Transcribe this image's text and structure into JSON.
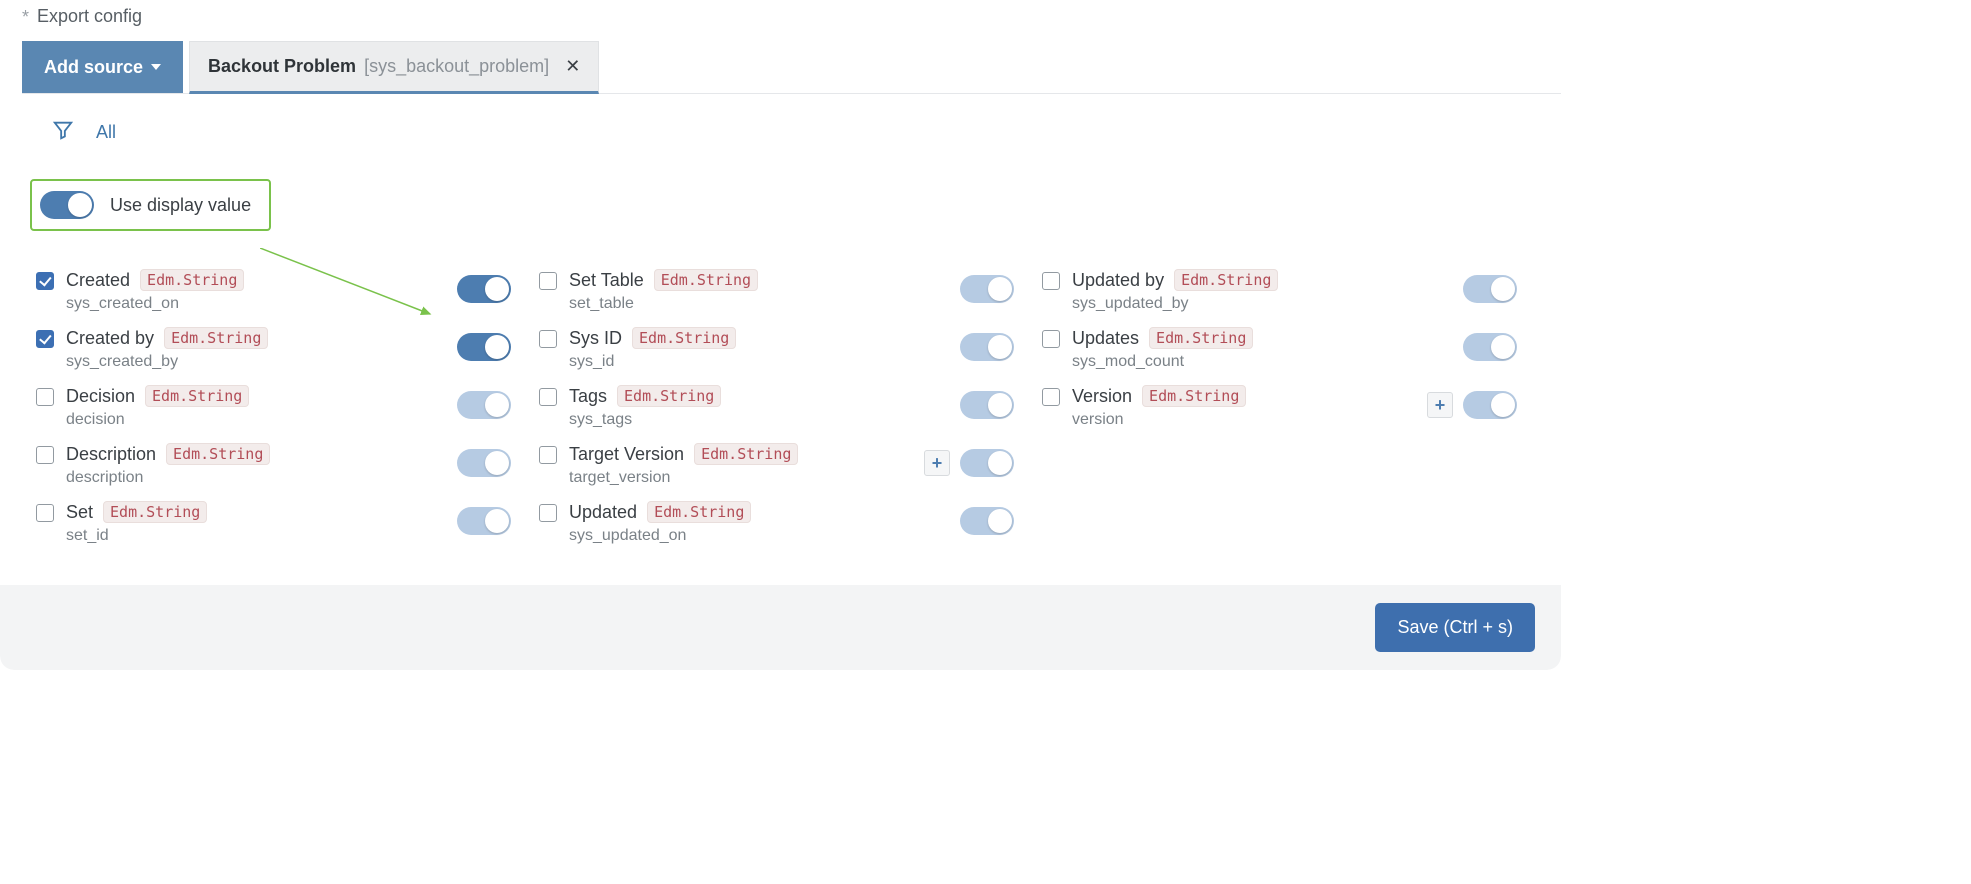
{
  "breadcrumb": {
    "label": "Export config"
  },
  "toolbar": {
    "add_source_label": "Add source"
  },
  "tabs": [
    {
      "title": "Backout Problem",
      "subtitle": "[sys_backout_problem]",
      "active": true
    }
  ],
  "filter": {
    "all_label": "All"
  },
  "display_value": {
    "label": "Use display value",
    "on": true
  },
  "columns": [
    [
      {
        "label": "Created",
        "sys": "sys_created_on",
        "type": "Edm.String",
        "checked": true,
        "toggle_on": true,
        "plus": false
      },
      {
        "label": "Created by",
        "sys": "sys_created_by",
        "type": "Edm.String",
        "checked": true,
        "toggle_on": true,
        "plus": false
      },
      {
        "label": "Decision",
        "sys": "decision",
        "type": "Edm.String",
        "checked": false,
        "toggle_on": false,
        "plus": false
      },
      {
        "label": "Description",
        "sys": "description",
        "type": "Edm.String",
        "checked": false,
        "toggle_on": false,
        "plus": false
      },
      {
        "label": "Set",
        "sys": "set_id",
        "type": "Edm.String",
        "checked": false,
        "toggle_on": false,
        "plus": false
      }
    ],
    [
      {
        "label": "Set Table",
        "sys": "set_table",
        "type": "Edm.String",
        "checked": false,
        "toggle_on": false,
        "plus": false
      },
      {
        "label": "Sys ID",
        "sys": "sys_id",
        "type": "Edm.String",
        "checked": false,
        "toggle_on": false,
        "plus": false
      },
      {
        "label": "Tags",
        "sys": "sys_tags",
        "type": "Edm.String",
        "checked": false,
        "toggle_on": false,
        "plus": false
      },
      {
        "label": "Target Version",
        "sys": "target_version",
        "type": "Edm.String",
        "checked": false,
        "toggle_on": false,
        "plus": true
      },
      {
        "label": "Updated",
        "sys": "sys_updated_on",
        "type": "Edm.String",
        "checked": false,
        "toggle_on": false,
        "plus": false
      }
    ],
    [
      {
        "label": "Updated by",
        "sys": "sys_updated_by",
        "type": "Edm.String",
        "checked": false,
        "toggle_on": false,
        "plus": false
      },
      {
        "label": "Updates",
        "sys": "sys_mod_count",
        "type": "Edm.String",
        "checked": false,
        "toggle_on": false,
        "plus": false
      },
      {
        "label": "Version",
        "sys": "version",
        "type": "Edm.String",
        "checked": false,
        "toggle_on": false,
        "plus": true
      }
    ]
  ],
  "footer": {
    "save_label": "Save (Ctrl + s)"
  },
  "colors": {
    "primary": "#4d7db0",
    "accent_green": "#7ac24b",
    "type_badge": "#b24d57"
  }
}
